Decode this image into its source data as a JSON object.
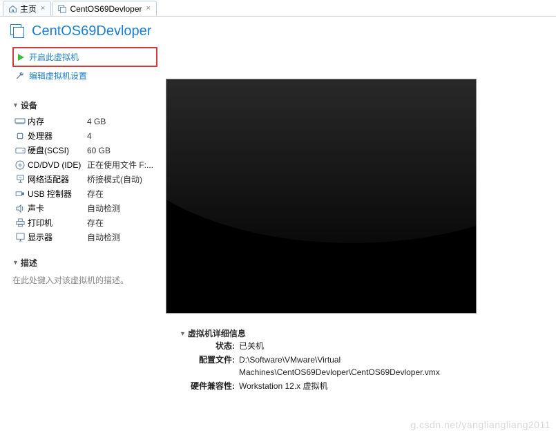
{
  "tabs": [
    {
      "label": "主页"
    },
    {
      "label": "CentOS69Devloper"
    }
  ],
  "title": "CentOS69Devloper",
  "actions": {
    "power_on": "开启此虚拟机",
    "edit_settings": "编辑虚拟机设置"
  },
  "sections": {
    "devices": "设备",
    "description": "描述",
    "details": "虚拟机详细信息"
  },
  "devices": [
    {
      "icon": "memory",
      "label": "内存",
      "value": "4 GB"
    },
    {
      "icon": "cpu",
      "label": "处理器",
      "value": "4"
    },
    {
      "icon": "disk",
      "label": "硬盘(SCSI)",
      "value": "60 GB"
    },
    {
      "icon": "cd",
      "label": "CD/DVD (IDE)",
      "value": "正在使用文件 F:..."
    },
    {
      "icon": "net",
      "label": "网络适配器",
      "value": "桥接模式(自动)"
    },
    {
      "icon": "usb",
      "label": "USB 控制器",
      "value": "存在"
    },
    {
      "icon": "sound",
      "label": "声卡",
      "value": "自动检测"
    },
    {
      "icon": "printer",
      "label": "打印机",
      "value": "存在"
    },
    {
      "icon": "display",
      "label": "显示器",
      "value": "自动检测"
    }
  ],
  "description_placeholder": "在此处键入对该虚拟机的描述。",
  "details": {
    "status_label": "状态:",
    "status_value": "已关机",
    "config_label": "配置文件:",
    "config_value": "D:\\Software\\VMware\\Virtual Machines\\CentOS69Devloper\\CentOS69Devloper.vmx",
    "compat_label": "硬件兼容性:",
    "compat_value": "Workstation 12.x 虚拟机"
  },
  "watermark": "g.csdn.net/yangliangliang2011"
}
